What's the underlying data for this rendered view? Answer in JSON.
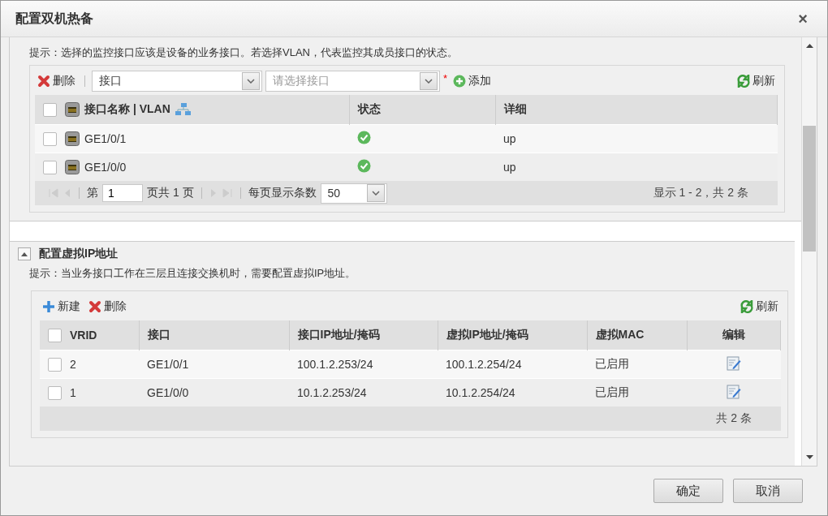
{
  "window": {
    "title": "配置双机热备",
    "close": "×"
  },
  "monitor": {
    "hint": "提示：选择的监控接口应该是设备的业务接口。若选择VLAN，代表监控其成员接口的状态。",
    "toolbar": {
      "delete": "删除",
      "type_value": "接口",
      "interface_placeholder": "请选择接口",
      "required": "*",
      "add": "添加",
      "refresh": "刷新"
    },
    "columns": [
      {
        "label": "接口名称 | VLAN"
      },
      {
        "label": "状态"
      },
      {
        "label": "详细"
      }
    ],
    "header_checked": false,
    "rows": [
      {
        "checked": false,
        "name": "GE1/0/1",
        "kind": "ok",
        "detail": "up"
      },
      {
        "checked": false,
        "name": "GE1/0/0",
        "kind": "ok",
        "detail": "up"
      }
    ],
    "pager": {
      "page_prefix": "第",
      "page": "1",
      "page_suffix": "页共 1 页",
      "per_page_label": "每页显示条数",
      "per_page": "50",
      "summary": "显示 1 - 2，共 2 条"
    }
  },
  "vip": {
    "title": "配置虚拟IP地址",
    "expanded": true,
    "hint": "提示：当业务接口工作在三层且连接交换机时，需要配置虚拟IP地址。",
    "toolbar": {
      "new": "新建",
      "delete": "删除",
      "refresh": "刷新"
    },
    "header_checked": false,
    "columns": [
      {
        "label": "VRID"
      },
      {
        "label": "接口"
      },
      {
        "label": "接口IP地址/掩码"
      },
      {
        "label": "虚拟IP地址/掩码"
      },
      {
        "label": "虚拟MAC"
      },
      {
        "label": "编辑"
      }
    ],
    "rows": [
      {
        "checked": false,
        "vrid": "2",
        "interface": "GE1/0/1",
        "ip": "100.1.2.253/24",
        "vip": "100.1.2.254/24",
        "mac": "已启用"
      },
      {
        "checked": false,
        "vrid": "1",
        "interface": "GE1/0/0",
        "ip": "10.1.2.253/24",
        "vip": "10.1.2.254/24",
        "mac": "已启用"
      }
    ],
    "total": "共 2 条"
  },
  "buttons": [
    {
      "label": "确定"
    },
    {
      "label": "取消"
    }
  ]
}
